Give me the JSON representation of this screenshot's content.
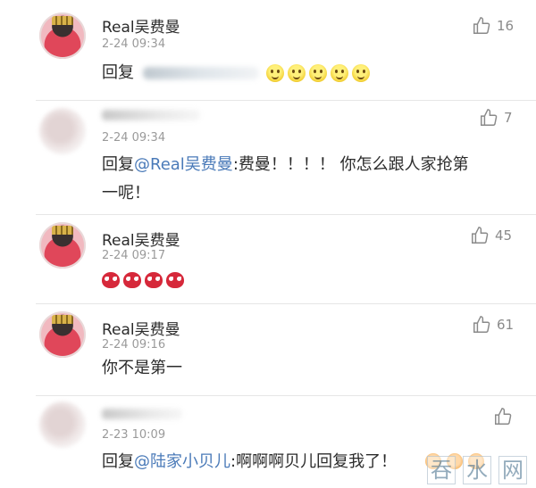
{
  "comments": [
    {
      "username": "Real吴费曼",
      "time": "2-24 09:34",
      "likes": "16",
      "reply_prefix": "回复",
      "emoji_count": 5
    },
    {
      "username": "",
      "time": "2-24 09:34",
      "likes": "7",
      "reply_prefix": "回复",
      "mention": "@Real吴费曼",
      "text_line1": ":费曼！！！！ 你怎么跟人家抢第",
      "text_line2": "一呢！"
    },
    {
      "username": "Real吴费曼",
      "time": "2-24 09:17",
      "likes": "45",
      "emoji_count": 4
    },
    {
      "username": "Real吴费曼",
      "time": "2-24 09:16",
      "likes": "61",
      "text": "你不是第一"
    },
    {
      "username": "",
      "time": "2-23 10:09",
      "likes": "",
      "reply_prefix": "回复",
      "mention": "@陆家小贝儿",
      "text": ":啊啊啊贝儿回复我了！"
    }
  ],
  "watermark": [
    "吞",
    "水",
    "网"
  ],
  "icons": {
    "like": "thumbs-up-icon",
    "smile_emoji": "smile-emoji-icon",
    "spider_emoji": "spiderman-emoji-icon"
  },
  "colors": {
    "mention": "#4a7ab8",
    "meta": "#9a9a9a"
  }
}
